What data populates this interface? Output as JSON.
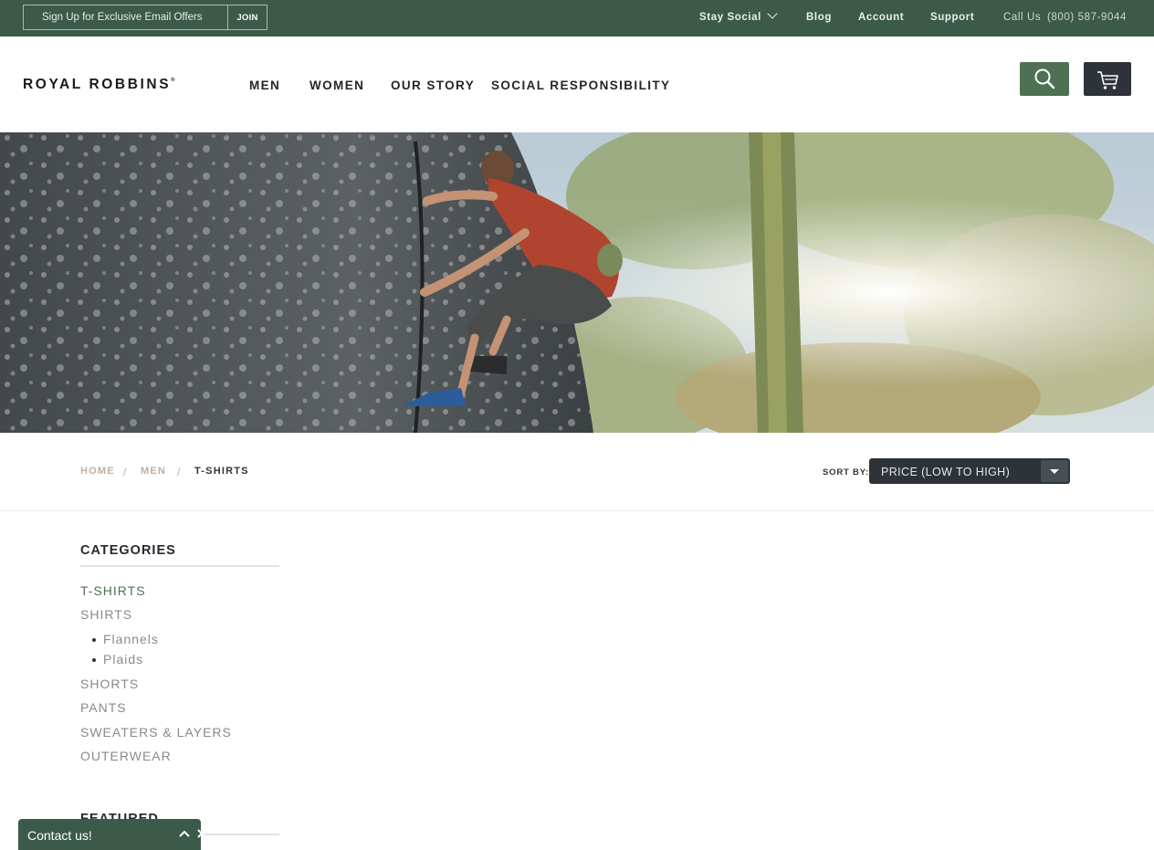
{
  "topbar": {
    "signup_placeholder": "Sign Up for Exclusive Email Offers",
    "join_label": "JOIN",
    "stay_social": "Stay Social",
    "blog": "Blog",
    "account": "Account",
    "support": "Support",
    "call_label": "Call Us",
    "phone": "(800) 587-9044"
  },
  "header": {
    "logo_text": "ROYAL ROBBINS",
    "logo_mark": "®",
    "nav": [
      "MEN",
      "WOMEN",
      "OUR STORY",
      "SOCIAL RESPONSIBILITY"
    ],
    "search_icon": "search-icon",
    "cart_icon": "cart-icon"
  },
  "breadcrumb": [
    "HOME",
    "MEN",
    "T-SHIRTS"
  ],
  "breadcrumb_sep": "/",
  "sort": {
    "label": "SORT BY:",
    "value": "PRICE (LOW TO HIGH)"
  },
  "sidebar": {
    "categories_title": "CATEGORIES",
    "categories": [
      "T-SHIRTS",
      "SHIRTS"
    ],
    "subcategories": [
      "Flannels",
      "Plaids"
    ],
    "more_categories": [
      "SHORTS",
      "PANTS",
      "SWEATERS & LAYERS",
      "OUTERWEAR"
    ],
    "featured_title": "FEATURED"
  },
  "contact": {
    "label": "Contact us!"
  },
  "colors": {
    "topbar": "#3c5a4a",
    "accent_green": "#4d7152",
    "dark": "#2d3338",
    "breadcrumb_link": "#c0b09a"
  }
}
